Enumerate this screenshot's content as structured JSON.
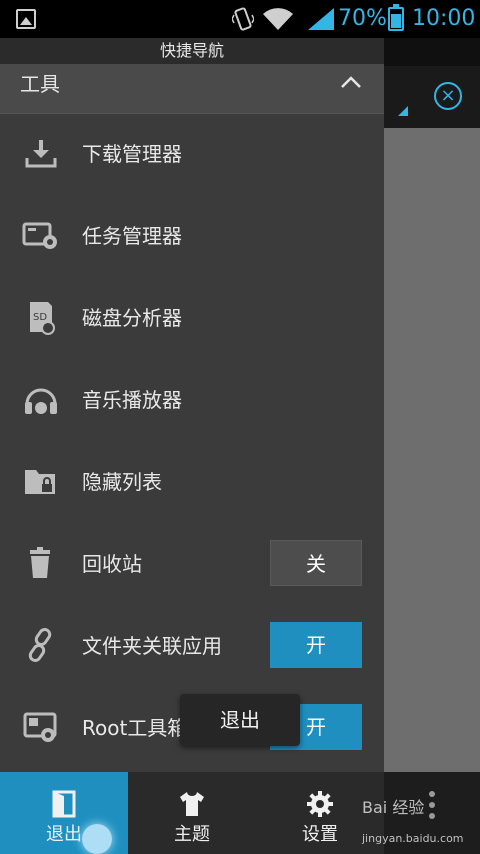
{
  "status_bar": {
    "battery_percent": "70%",
    "time": "10:00",
    "accent_color": "#33b5e5"
  },
  "drawer": {
    "title": "快捷导航",
    "section": {
      "label": "工具",
      "state": "expanded"
    },
    "items": [
      {
        "label": "下载管理器",
        "icon": "download-icon"
      },
      {
        "label": "任务管理器",
        "icon": "task-manager-icon"
      },
      {
        "label": "磁盘分析器",
        "icon": "sd-card-icon"
      },
      {
        "label": "音乐播放器",
        "icon": "headphones-icon"
      },
      {
        "label": "隐藏列表",
        "icon": "locked-folder-icon"
      },
      {
        "label": "回收站",
        "icon": "trash-icon",
        "toggle": "关",
        "toggle_state": "off"
      },
      {
        "label": "文件夹关联应用",
        "icon": "link-icon",
        "toggle": "开",
        "toggle_state": "on"
      },
      {
        "label": "Root工具箱",
        "icon": "root-toolbox-icon",
        "toggle": "开",
        "toggle_state": "on"
      }
    ]
  },
  "toast": {
    "text": "退出"
  },
  "bottom_bar": {
    "tabs": [
      {
        "label": "退出",
        "icon": "exit-door-icon",
        "active": true
      },
      {
        "label": "主题",
        "icon": "shirt-icon",
        "active": false
      },
      {
        "label": "设置",
        "icon": "gear-icon",
        "active": false
      }
    ]
  },
  "watermark": {
    "brand": "Bai 经验",
    "url": "jingyan.baidu.com"
  },
  "colors": {
    "drawer_bg": "#3b3b3b",
    "toggle_on": "#1e8fbf",
    "toggle_off": "#4d4d4d",
    "active_tab": "#1e8fbf"
  }
}
